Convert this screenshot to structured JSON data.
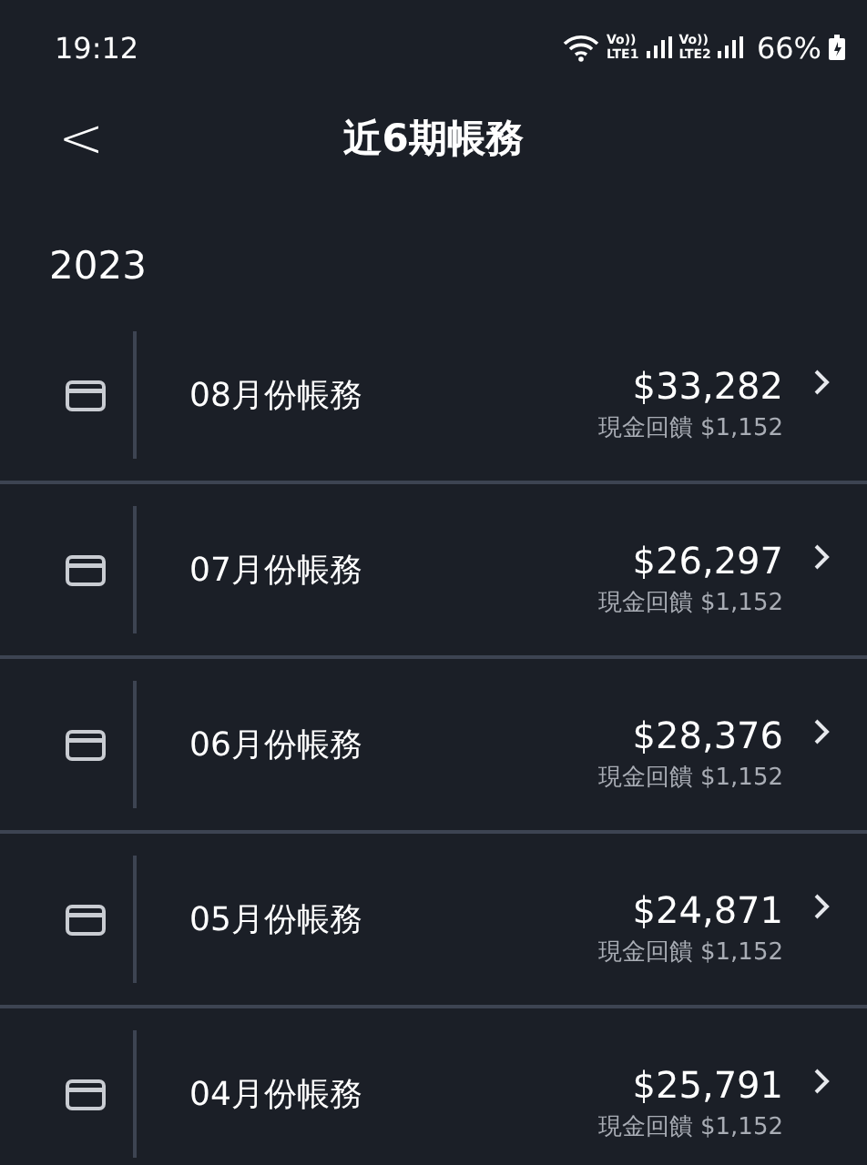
{
  "status_bar": {
    "time": "19:12",
    "sim1_volte": "Vo))",
    "sim1_label": "LTE1",
    "sim2_volte": "Vo))",
    "sim2_label": "LTE2",
    "battery": "66%"
  },
  "header": {
    "back": "<",
    "title": "近6期帳務"
  },
  "year": "2023",
  "statements": [
    {
      "label": "08月份帳務",
      "amount": "$33,282",
      "cashback": "現金回饋 $1,152"
    },
    {
      "label": "07月份帳務",
      "amount": "$26,297",
      "cashback": "現金回饋 $1,152"
    },
    {
      "label": "06月份帳務",
      "amount": "$28,376",
      "cashback": "現金回饋 $1,152"
    },
    {
      "label": "05月份帳務",
      "amount": "$24,871",
      "cashback": "現金回饋 $1,152"
    },
    {
      "label": "04月份帳務",
      "amount": "$25,791",
      "cashback": "現金回饋 $1,152"
    }
  ]
}
